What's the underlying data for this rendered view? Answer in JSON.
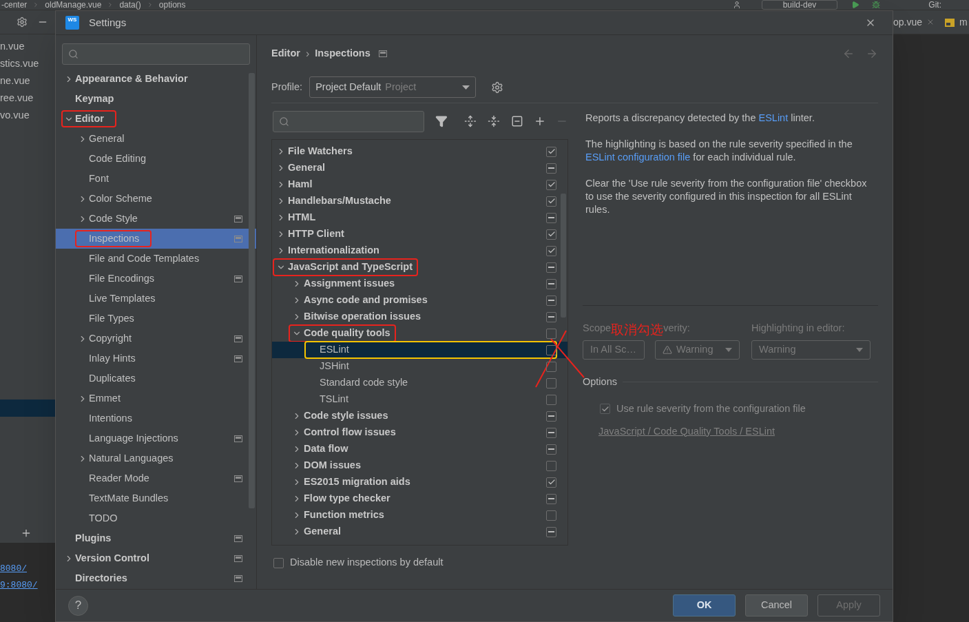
{
  "ide": {
    "breadcrumbs": [
      "-center",
      "oldManage.vue",
      "data()",
      "options"
    ],
    "run_config": "build-dev",
    "vcs_label": "Git:",
    "project_files": [
      "n.vue",
      "stics.vue",
      "ne.vue",
      "ree.vue",
      "vo.vue"
    ],
    "editor_tabs": [
      "op.vue",
      "m"
    ],
    "terminal_links": [
      "8080/",
      "9:8080/"
    ]
  },
  "dialog": {
    "logo": "WS",
    "title": "Settings",
    "nav": [
      {
        "label": "Appearance & Behavior",
        "expanded": false,
        "selected": false,
        "project_level": false
      },
      {
        "label": "Keymap",
        "selected": false,
        "project_level": false
      },
      {
        "label": "Editor",
        "expanded": true,
        "selected": false,
        "project_level": false,
        "color": "#e8231d",
        "children": [
          {
            "label": "General",
            "expanded": false,
            "selected": false,
            "project_level": false
          },
          {
            "label": "Code Editing",
            "selected": false,
            "project_level": false
          },
          {
            "label": "Font",
            "selected": false,
            "project_level": false
          },
          {
            "label": "Color Scheme",
            "expanded": false,
            "selected": false,
            "project_level": false
          },
          {
            "label": "Code Style",
            "expanded": false,
            "selected": false,
            "project_level": true
          },
          {
            "label": "Inspections",
            "selected": true,
            "project_level": true,
            "color": "#e8231d"
          },
          {
            "label": "File and Code Templates",
            "selected": false,
            "project_level": false
          },
          {
            "label": "File Encodings",
            "selected": false,
            "project_level": true
          },
          {
            "label": "Live Templates",
            "selected": false,
            "project_level": false
          },
          {
            "label": "File Types",
            "selected": false,
            "project_level": false
          },
          {
            "label": "Copyright",
            "expanded": false,
            "selected": false,
            "project_level": true
          },
          {
            "label": "Inlay Hints",
            "selected": false,
            "project_level": true
          },
          {
            "label": "Duplicates",
            "selected": false,
            "project_level": false
          },
          {
            "label": "Emmet",
            "expanded": false,
            "selected": false,
            "project_level": false
          },
          {
            "label": "Intentions",
            "selected": false,
            "project_level": false
          },
          {
            "label": "Language Injections",
            "selected": false,
            "project_level": true
          },
          {
            "label": "Natural Languages",
            "expanded": false,
            "selected": false,
            "project_level": false
          },
          {
            "label": "Reader Mode",
            "selected": false,
            "project_level": true
          },
          {
            "label": "TextMate Bundles",
            "selected": false,
            "project_level": false
          },
          {
            "label": "TODO",
            "selected": false,
            "project_level": false
          }
        ]
      },
      {
        "label": "Plugins",
        "selected": false,
        "project_level": true
      },
      {
        "label": "Version Control",
        "expanded": false,
        "selected": false,
        "project_level": true
      },
      {
        "label": "Directories",
        "selected": false,
        "project_level": true
      }
    ],
    "breadcrumb": [
      "Editor",
      "Inspections"
    ],
    "breadcrumb_separator": "›",
    "profile": {
      "label": "Profile:",
      "value": "Project Default",
      "scope": "Project"
    },
    "inspections": [
      {
        "label": "File Watchers",
        "expanded": false,
        "checked": true,
        "selected": false
      },
      {
        "label": "General",
        "expanded": false,
        "partial": true,
        "selected": false
      },
      {
        "label": "Haml",
        "expanded": false,
        "checked": true,
        "selected": false
      },
      {
        "label": "Handlebars/Mustache",
        "expanded": false,
        "checked": true,
        "selected": false
      },
      {
        "label": "HTML",
        "expanded": false,
        "partial": true,
        "selected": false
      },
      {
        "label": "HTTP Client",
        "expanded": false,
        "checked": true,
        "selected": false
      },
      {
        "label": "Internationalization",
        "expanded": false,
        "checked": true,
        "selected": false
      },
      {
        "label": "JavaScript and TypeScript",
        "expanded": true,
        "partial": true,
        "selected": false,
        "color": "#e8231d",
        "children": [
          {
            "label": "Assignment issues",
            "expanded": false,
            "partial": true,
            "selected": false
          },
          {
            "label": "Async code and promises",
            "expanded": false,
            "partial": true,
            "selected": false
          },
          {
            "label": "Bitwise operation issues",
            "expanded": false,
            "partial": true,
            "selected": false
          },
          {
            "label": "Code quality tools",
            "expanded": true,
            "checked": false,
            "selected": false,
            "color": "#e8231d",
            "children": [
              {
                "label": "ESLint",
                "checked": false,
                "selected": true,
                "color": "#f5c400"
              },
              {
                "label": "JSHint",
                "checked": false,
                "selected": false
              },
              {
                "label": "Standard code style",
                "checked": false,
                "selected": false
              },
              {
                "label": "TSLint",
                "checked": false,
                "selected": false
              }
            ]
          },
          {
            "label": "Code style issues",
            "expanded": false,
            "partial": true,
            "selected": false
          },
          {
            "label": "Control flow issues",
            "expanded": false,
            "partial": true,
            "selected": false
          },
          {
            "label": "Data flow",
            "expanded": false,
            "partial": true,
            "selected": false
          },
          {
            "label": "DOM issues",
            "expanded": false,
            "checked": false,
            "selected": false
          },
          {
            "label": "ES2015 migration aids",
            "expanded": false,
            "checked": true,
            "selected": false
          },
          {
            "label": "Flow type checker",
            "expanded": false,
            "partial": true,
            "selected": false
          },
          {
            "label": "Function metrics",
            "expanded": false,
            "checked": false,
            "selected": false
          },
          {
            "label": "General",
            "expanded": false,
            "partial": true,
            "selected": false
          }
        ]
      }
    ],
    "description": [
      [
        {
          "text": "Reports a discrepancy detected by the "
        },
        {
          "text": "ESLint",
          "link": true
        },
        {
          "text": " linter."
        }
      ],
      [
        {
          "text": "The highlighting is based on the rule severity specified in the "
        },
        {
          "text": "ESLint configuration file",
          "link": true
        },
        {
          "text": " for each individual rule."
        }
      ],
      [
        {
          "text": "Clear the 'Use rule severity from the configuration file' checkbox to use the severity configured in this inspection for all ESLint rules."
        }
      ]
    ],
    "scope": {
      "label": "Scope",
      "value": "In All Sc…",
      "disabled": true
    },
    "annotation_text": "取消勾选",
    "severity": {
      "label": "verity:",
      "value": "Warning",
      "disabled": true
    },
    "highlighting": {
      "label": "Highlighting in editor:",
      "value": "Warning",
      "disabled": true
    },
    "options": {
      "title": "Options",
      "checkbox": {
        "label": "Use rule severity from the configuration file",
        "checked": true,
        "disabled": true
      },
      "path_link": "JavaScript / Code Quality Tools / ESLint"
    },
    "disable_new": {
      "label": "Disable new inspections by default",
      "checked": false
    },
    "help": "?",
    "buttons": [
      {
        "label": "OK",
        "kind": "primary"
      },
      {
        "label": "Cancel",
        "kind": "normal"
      },
      {
        "label": "Apply",
        "kind": "disabled"
      }
    ]
  }
}
